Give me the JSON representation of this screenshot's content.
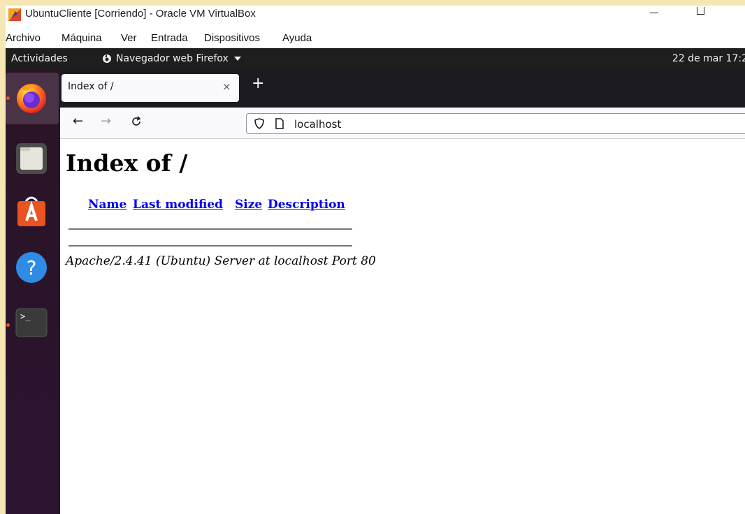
{
  "vm_window": {
    "title": "UbuntuCliente [Corriendo] - Oracle VM VirtualBox",
    "menu": [
      "Archivo",
      "Máquina",
      "Ver",
      "Entrada",
      "Dispositivos",
      "Ayuda"
    ]
  },
  "gnome": {
    "activities": "Actividades",
    "app_menu": "Navegador web Firefox",
    "clock": "22 de mar  17:2"
  },
  "dock": {
    "items": [
      "firefox-icon",
      "files-icon",
      "software-icon",
      "help-icon",
      "terminal-icon"
    ]
  },
  "browser": {
    "tab_title": "Index of /",
    "url": "localhost"
  },
  "page": {
    "heading": "Index of /",
    "columns": [
      "Name",
      "Last modified",
      "Size",
      "Description"
    ],
    "footer": "Apache/2.4.41 (Ubuntu) Server at localhost Port 80"
  },
  "colors": {
    "accent": "#e95420",
    "link": "#0000ee",
    "dock_bg": "#2c1630"
  }
}
